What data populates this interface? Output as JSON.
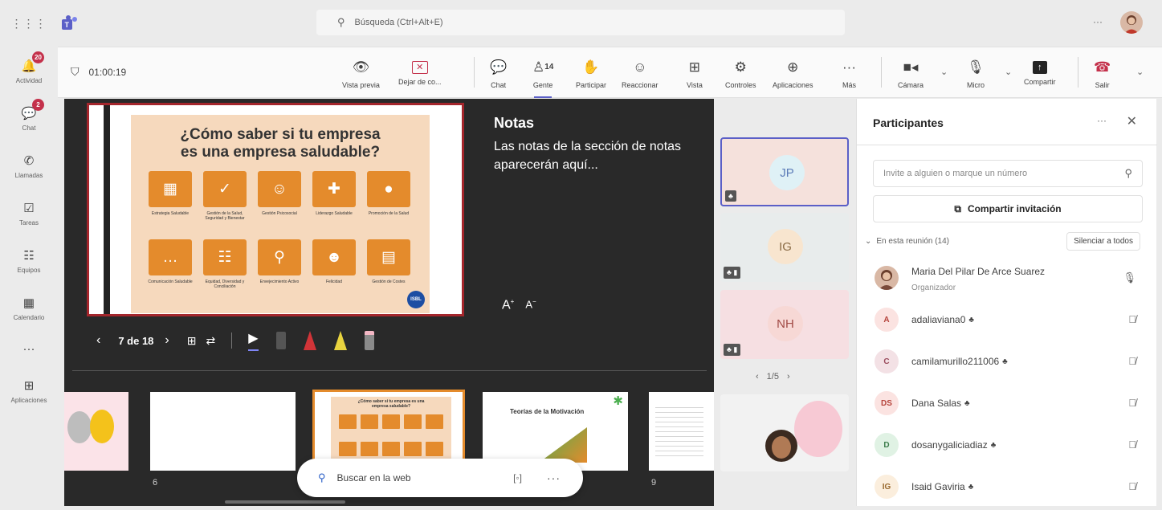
{
  "search": {
    "placeholder": "Búsqueda (Ctrl+Alt+E)"
  },
  "rail": {
    "items": [
      {
        "label": "Actividad",
        "badge": "20",
        "icon": "bell-icon"
      },
      {
        "label": "Chat",
        "badge": "2",
        "icon": "chat-icon"
      },
      {
        "label": "Llamadas",
        "badge": "",
        "icon": "phone-icon"
      },
      {
        "label": "Tareas",
        "badge": "",
        "icon": "tasks-icon"
      },
      {
        "label": "Equipos",
        "badge": "",
        "icon": "teams-icon"
      },
      {
        "label": "Calendario",
        "badge": "",
        "icon": "calendar-icon"
      },
      {
        "label": "...",
        "badge": "",
        "icon": "more-icon"
      },
      {
        "label": "Aplicaciones",
        "badge": "",
        "icon": "plus-icon"
      }
    ]
  },
  "meeting": {
    "timer": "01:00:19",
    "toolbar": {
      "preview": "Vista previa",
      "stop_share": "Dejar de co...",
      "chat": "Chat",
      "people": "Gente",
      "people_count": "14",
      "participate": "Participar",
      "react": "Reaccionar",
      "view": "Vista",
      "controls": "Controles",
      "apps": "Aplicaciones",
      "more": "Más",
      "camera": "Cámara",
      "mic": "Micro",
      "share": "Compartir",
      "leave": "Salir"
    }
  },
  "slide": {
    "title": "¿Cómo saber si tu empresa es una empresa saludable?",
    "tiles": [
      {
        "icon": "strategy-icon",
        "glyph": "▦",
        "label": "Estrategia Saludable"
      },
      {
        "icon": "shield-icon",
        "glyph": "✓",
        "label": "Gestión de la Salud, Seguridad y Bienestar"
      },
      {
        "icon": "head-icon",
        "glyph": "☺",
        "label": "Gestión Psicosocial"
      },
      {
        "icon": "leader-icon",
        "glyph": "✚",
        "label": "Liderazgo Saludable"
      },
      {
        "icon": "apple-icon",
        "glyph": "●",
        "label": "Promoción de la Salud"
      },
      {
        "icon": "speech-icon",
        "glyph": "…",
        "label": "Comunicación Saludable"
      },
      {
        "icon": "people-icon",
        "glyph": "☷",
        "label": "Equidad, Diversidad y Conciliación"
      },
      {
        "icon": "walker-icon",
        "glyph": "⚲",
        "label": "Envejecimiento Activo"
      },
      {
        "icon": "smile-icon",
        "glyph": "☻",
        "label": "Felicidad"
      },
      {
        "icon": "calculator-icon",
        "glyph": "▤",
        "label": "Gestión de Costes"
      }
    ],
    "logo": "ISBL"
  },
  "notes": {
    "title": "Notas",
    "body": "Las notas de la sección de notas aparecerán aquí..."
  },
  "slide_nav": {
    "position": "7 de 18"
  },
  "thumbnails": [
    {
      "number": "",
      "title": ""
    },
    {
      "number": "6",
      "title": ""
    },
    {
      "number": "",
      "title": "¿Cómo saber si tu empresa es una empresa saludable?"
    },
    {
      "number": "",
      "title": "Teorías de la Motivación"
    },
    {
      "number": "9",
      "title": ""
    }
  ],
  "bing": {
    "placeholder": "Buscar en la web"
  },
  "video": {
    "tiles": [
      {
        "initials": "JP",
        "bg": "#f5e1dc",
        "avbg": "#dff1f6",
        "color": "#5c7cb8"
      },
      {
        "initials": "IG",
        "bg": "#e8ecec",
        "avbg": "#f8e5cf",
        "color": "#8a6b45"
      },
      {
        "initials": "NH",
        "bg": "#f6dfe2",
        "avbg": "#f7d8d5",
        "color": "#a14a45"
      }
    ],
    "pager": "1/5"
  },
  "panel": {
    "title": "Participantes",
    "invite_placeholder": "Invite a alguien o marque un número",
    "share_invite": "Compartir invitación",
    "section": "En esta reunión (14)",
    "mute_all": "Silenciar a todos",
    "participants": [
      {
        "initials": "",
        "name": "Maria Del Pilar De Arce Suarez",
        "role": "Organizador",
        "avbg": "#d9b8a5",
        "avcolor": "#6b3f2d",
        "mic": "on"
      },
      {
        "initials": "A",
        "name": "adaliaviana0",
        "role": "",
        "avbg": "#fbe3e1",
        "avcolor": "#b5433b",
        "mic": "off"
      },
      {
        "initials": "C",
        "name": "camilamurillo211006",
        "role": "",
        "avbg": "#f3e1e5",
        "avcolor": "#9a4b5c",
        "mic": "off"
      },
      {
        "initials": "DS",
        "name": "Dana Salas",
        "role": "",
        "avbg": "#fbe3e1",
        "avcolor": "#b5433b",
        "mic": "off"
      },
      {
        "initials": "D",
        "name": "dosanygaliciadiaz",
        "role": "",
        "avbg": "#e0f2e4",
        "avcolor": "#3c7d4b",
        "mic": "off"
      },
      {
        "initials": "IG",
        "name": "Isaid Gaviria",
        "role": "",
        "avbg": "#fbeedd",
        "avcolor": "#9a6a2f",
        "mic": "off"
      }
    ]
  }
}
